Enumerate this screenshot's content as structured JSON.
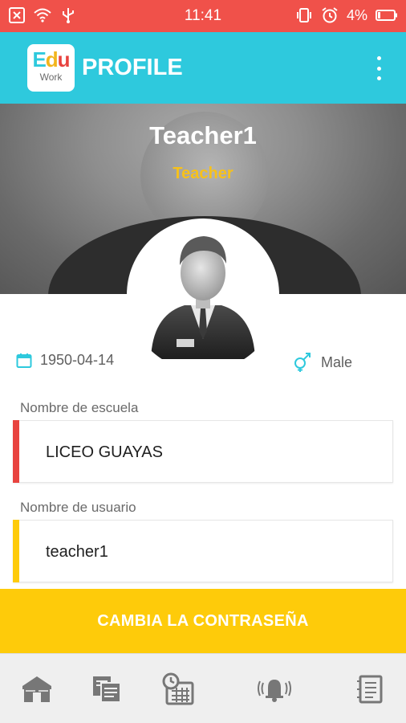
{
  "status_bar": {
    "time": "11:41",
    "battery": "4%",
    "left_icons": [
      "close-box-icon",
      "wifi-icon",
      "usb-icon"
    ],
    "right_icons": [
      "vibrate-icon",
      "alarm-icon",
      "battery-low-icon"
    ]
  },
  "app_bar": {
    "logo_top": "Edu",
    "logo_bottom": "Work",
    "title": "PROFILE",
    "menu_icon": "more-vertical-icon"
  },
  "profile": {
    "name": "Teacher1",
    "role": "Teacher",
    "birth_date": "1950-04-14",
    "gender": "Male"
  },
  "fields": [
    {
      "label": "Nombre de escuela",
      "value": "LICEO GUAYAS",
      "accent": "#e8433f"
    },
    {
      "label": "Nombre de usuario",
      "value": "teacher1",
      "accent": "#fecb0a"
    }
  ],
  "actions": {
    "change_password": "CAMBIA LA CONTRASEÑA"
  },
  "bottom_nav": [
    {
      "icon": "school-icon"
    },
    {
      "icon": "documents-icon"
    },
    {
      "icon": "schedule-icon"
    },
    {
      "icon": "notifications-icon"
    },
    {
      "icon": "notebook-icon"
    }
  ],
  "colors": {
    "status_bar": "#f0514a",
    "app_bar": "#2ec9dd",
    "role_text": "#f7c11a",
    "button": "#fecb0a",
    "nav_bg": "#efefef"
  }
}
